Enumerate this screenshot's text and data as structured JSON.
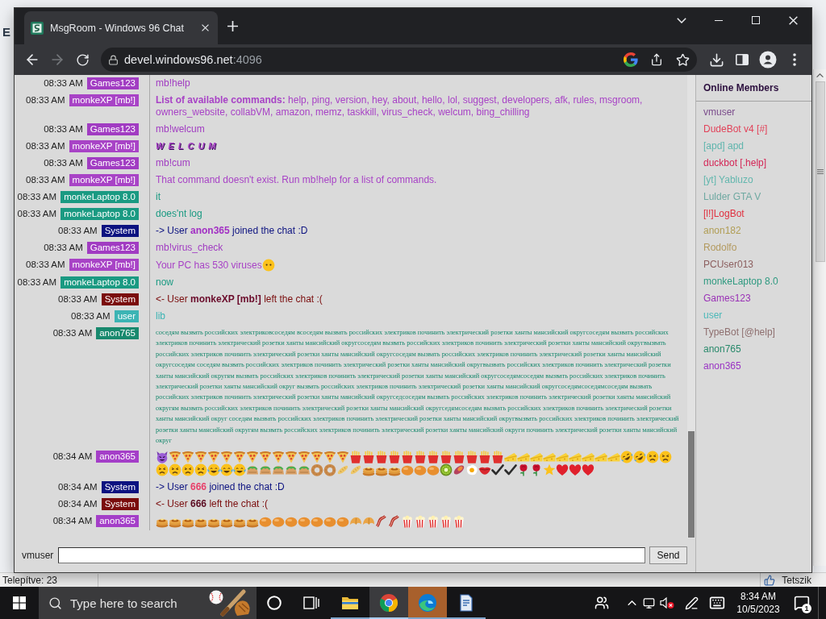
{
  "background_window": {
    "edge_letter": "E",
    "status": "Telepítve: 23",
    "like": "Tetszik"
  },
  "browser": {
    "tab": {
      "title": "MsgRoom - Windows 96 Chat",
      "selected": true
    },
    "address": {
      "host": "devel.windows96.net",
      "port": ":4096"
    }
  },
  "chat": {
    "messages": [
      {
        "time": "08:33 AM",
        "user": "Games123",
        "color": "#a13cc2",
        "kind": "text",
        "text": "mb!help"
      },
      {
        "time": "08:33 AM",
        "user": "monkeXP [mb!]",
        "color": "#a843c6",
        "kind": "text",
        "text": "**List of available commands:** help, ping, version, hey, about, hello, lol, suggest, developers, afk, rules, msgroom, owners_website, collabVM, amazon, memz, taskkill, virus_check, welcum, bing_chilling"
      },
      {
        "time": "08:33 AM",
        "user": "Games123",
        "color": "#a13cc2",
        "kind": "text",
        "text": "mb!welcum"
      },
      {
        "time": "08:33 AM",
        "user": "monkeXP [mb!]",
        "color": "#a843c6",
        "kind": "wordart",
        "text": "WELCUM"
      },
      {
        "time": "08:33 AM",
        "user": "Games123",
        "color": "#a13cc2",
        "kind": "text",
        "text": "mb!cum"
      },
      {
        "time": "08:33 AM",
        "user": "monkeXP [mb!]",
        "color": "#a843c6",
        "kind": "text",
        "text": "That command doesn't exist. Run mb!help for a list of commands."
      },
      {
        "time": "08:33 AM",
        "user": "monkeLaptop 8.0",
        "color": "#1a9a82",
        "kind": "text",
        "text": "it"
      },
      {
        "time": "08:33 AM",
        "user": "monkeLaptop 8.0",
        "color": "#1a9a82",
        "kind": "text",
        "text": "does'nt log"
      },
      {
        "time": "08:33 AM",
        "user": "System",
        "color": "#0c1280",
        "kind": "system",
        "text": "-> User **anon365** joined the chat :D",
        "mention": {
          "color": "#a22fc4"
        }
      },
      {
        "time": "08:33 AM",
        "user": "Games123",
        "color": "#a13cc2",
        "kind": "text",
        "text": "mb!virus_check"
      },
      {
        "time": "08:33 AM",
        "user": "monkeXP [mb!]",
        "color": "#a843c6",
        "kind": "text",
        "text": "Your PC has 530 viruses",
        "emoji": [
          {
            "kind": "speechless"
          }
        ]
      },
      {
        "time": "08:33 AM",
        "user": "monkeLaptop 8.0",
        "color": "#1a9a82",
        "kind": "text",
        "text": "now"
      },
      {
        "time": "08:33 AM",
        "user": "System",
        "color": "#7a0c0c",
        "kind": "system",
        "text": "<- User **monkeXP [mb!]** left the chat :(",
        "mention": {
          "color": "#6a0a2a"
        }
      },
      {
        "time": "08:33 AM",
        "user": "user",
        "color": "#3cb4b4",
        "kind": "text",
        "text": "lib"
      },
      {
        "time": "08:33 AM",
        "user": "anon765",
        "color": "#18896e",
        "kind": "small",
        "text": "соседям вызвать российских электриковсоседям всоседям вызвать российских электриков починить электрический розетки ханты мансийский округсоседям вызвать российских электриков починить электрический розетки ханты мансийский округсоседям вызвать российских электриков починить электрический розетки ханты мансийский округвызвать российских электриков починить электрический розетки ханты мансийский округсоседям вызвать российских электриков починить электрический розетки ханты мансийский округсоседям соседям вызвать российских электриков починить электрический розетки ханты мансийский округвызвать российских электриков починить электрический розетки ханты мансийский округям вызвать российских электриков починить электрический розетки ханты мансийский округсоседямсоседям вызвать российских электриков починить электрический розетки ханты мансийский округ вызвать российских электриков починить электрический розетки ханты мансийский округсоседямсоседямсоседям вызвать российских электриков починить электрический розетки ханты мансийский округседсоседям вызвать российских электриков починить электрический розетки ханты мансийский округям вызвать российских электриков починить электрический розетки ханты мансийский округседямсоседям вызвать российских электриков починить электрический розетки ханты мансийский округ соседям вызвать российских электриков починить электрический розетки ханты мансийский округвызвать российских электриков починить электрический розетки ханты мансийский округям вызвать российских электриков починить электрический розетки ханты мансийский округи починить электрический розетки ханты мансийский округ"
      },
      {
        "time": "08:34 AM",
        "user": "anon365",
        "color": "#a43ec8",
        "kind": "emoji",
        "emoji": [
          {
            "kind": "devil"
          },
          {
            "kind": "pizza"
          },
          {
            "kind": "pizza"
          },
          {
            "kind": "pizza"
          },
          {
            "kind": "pizza"
          },
          {
            "kind": "pizza"
          },
          {
            "kind": "pizza"
          },
          {
            "kind": "pizza"
          },
          {
            "kind": "pizza"
          },
          {
            "kind": "pizza"
          },
          {
            "kind": "pizza"
          },
          {
            "kind": "pizza"
          },
          {
            "kind": "pizza"
          },
          {
            "kind": "pizza"
          },
          {
            "kind": "pizza"
          },
          {
            "kind": "fries"
          },
          {
            "kind": "fries"
          },
          {
            "kind": "fries"
          },
          {
            "kind": "fries"
          },
          {
            "kind": "fries"
          },
          {
            "kind": "fries"
          },
          {
            "kind": "fries"
          },
          {
            "kind": "fries"
          },
          {
            "kind": "fries"
          },
          {
            "kind": "fries"
          },
          {
            "kind": "fries"
          },
          {
            "kind": "fries"
          },
          {
            "kind": "cheese"
          },
          {
            "kind": "cheese"
          },
          {
            "kind": "cheese"
          },
          {
            "kind": "cheese"
          },
          {
            "kind": "cheese"
          },
          {
            "kind": "cheese"
          },
          {
            "kind": "cheese"
          },
          {
            "kind": "cheese"
          },
          {
            "kind": "cheese"
          },
          {
            "kind": "rofl"
          },
          {
            "kind": "rofl"
          },
          {
            "kind": "weary"
          },
          {
            "kind": "weary"
          },
          {
            "kind": "weary"
          },
          {
            "kind": "weary"
          },
          {
            "kind": "weary"
          },
          {
            "kind": "weary"
          },
          {
            "kind": "joy"
          },
          {
            "kind": "joy"
          },
          {
            "kind": "joy"
          },
          {
            "kind": "pita"
          },
          {
            "kind": "pita"
          },
          {
            "kind": "pita"
          },
          {
            "kind": "pita"
          },
          {
            "kind": "pita"
          },
          {
            "kind": "bagel"
          },
          {
            "kind": "bagel"
          },
          {
            "kind": "baguette"
          },
          {
            "kind": "baguette"
          },
          {
            "kind": "pancakes"
          },
          {
            "kind": "pancakes"
          },
          {
            "kind": "pancakes"
          },
          {
            "kind": "bun"
          },
          {
            "kind": "bun"
          },
          {
            "kind": "bun"
          },
          {
            "kind": "kiwi"
          },
          {
            "kind": "yam"
          },
          {
            "kind": "egg"
          },
          {
            "kind": "lips"
          },
          {
            "kind": "check"
          },
          {
            "kind": "check"
          },
          {
            "kind": "rose"
          },
          {
            "kind": "rose"
          },
          {
            "kind": "star"
          },
          {
            "kind": "heart"
          },
          {
            "kind": "heart"
          },
          {
            "kind": "heart"
          }
        ]
      },
      {
        "time": "08:34 AM",
        "user": "System",
        "color": "#0c1280",
        "kind": "system",
        "text": "-> User **666** joined the chat :D",
        "mention": {
          "color": "#e8406a"
        }
      },
      {
        "time": "08:34 AM",
        "user": "System",
        "color": "#7a0c0c",
        "kind": "system",
        "text": "<- User **666** left the chat :(",
        "mention": {
          "color": "#5a0a20"
        }
      },
      {
        "time": "08:34 AM",
        "user": "anon365",
        "color": "#a43ec8",
        "kind": "emoji",
        "emoji": [
          {
            "kind": "pancakes"
          },
          {
            "kind": "pancakes"
          },
          {
            "kind": "pancakes"
          },
          {
            "kind": "pancakes"
          },
          {
            "kind": "pancakes"
          },
          {
            "kind": "pancakes"
          },
          {
            "kind": "pancakes"
          },
          {
            "kind": "pancakes"
          },
          {
            "kind": "bun"
          },
          {
            "kind": "bun"
          },
          {
            "kind": "bun"
          },
          {
            "kind": "bun"
          },
          {
            "kind": "bun"
          },
          {
            "kind": "bun"
          },
          {
            "kind": "bun"
          },
          {
            "kind": "cookie"
          },
          {
            "kind": "cookie"
          },
          {
            "kind": "bacon"
          },
          {
            "kind": "bacon"
          },
          {
            "kind": "popcorn"
          },
          {
            "kind": "popcorn"
          },
          {
            "kind": "popcorn"
          },
          {
            "kind": "popcorn"
          },
          {
            "kind": "popcorn"
          }
        ]
      }
    ],
    "input": {
      "username": "vmuser"
    },
    "send": "Send"
  },
  "members": {
    "title": "Online Members",
    "items": [
      {
        "name": "vmuser",
        "color": "#7b4d8c"
      },
      {
        "name": "DudeBot v4 [#]",
        "color": "#e2435a"
      },
      {
        "name": "[apd] apd",
        "color": "#5fb5ad"
      },
      {
        "name": "duckbot [.help]",
        "color": "#d42656"
      },
      {
        "name": "[yt] Yabluzo",
        "color": "#63b7ae"
      },
      {
        "name": "Lulder GTA V",
        "color": "#6fa9a2"
      },
      {
        "name": "[l!]LogBot",
        "color": "#e0303f"
      },
      {
        "name": "anon182",
        "color": "#b19e55"
      },
      {
        "name": "Rodolfo",
        "color": "#b39a5f"
      },
      {
        "name": "PCUser013",
        "color": "#8d6060"
      },
      {
        "name": "monkeLaptop 8.0",
        "color": "#2f9a80"
      },
      {
        "name": "Games123",
        "color": "#9a31b6"
      },
      {
        "name": "user",
        "color": "#4cb9b9"
      },
      {
        "name": "TypeBot [@help]",
        "color": "#8f7070"
      },
      {
        "name": "anon765",
        "color": "#2a8a6c"
      },
      {
        "name": "anon365",
        "color": "#9a34c4"
      }
    ]
  },
  "taskbar": {
    "search_placeholder": "Type here to search",
    "apps": [
      {
        "kind": "folder",
        "selected": false,
        "flashing": false,
        "running": true
      },
      {
        "kind": "chrome",
        "selected": true,
        "flashing": false,
        "running": true
      },
      {
        "kind": "edge",
        "selected": false,
        "flashing": true,
        "running": true
      },
      {
        "kind": "document",
        "selected": false,
        "flashing": false,
        "running": true
      }
    ],
    "clock": {
      "time": "8:34 AM",
      "date": "10/5/2023"
    },
    "notification_count": "1"
  }
}
